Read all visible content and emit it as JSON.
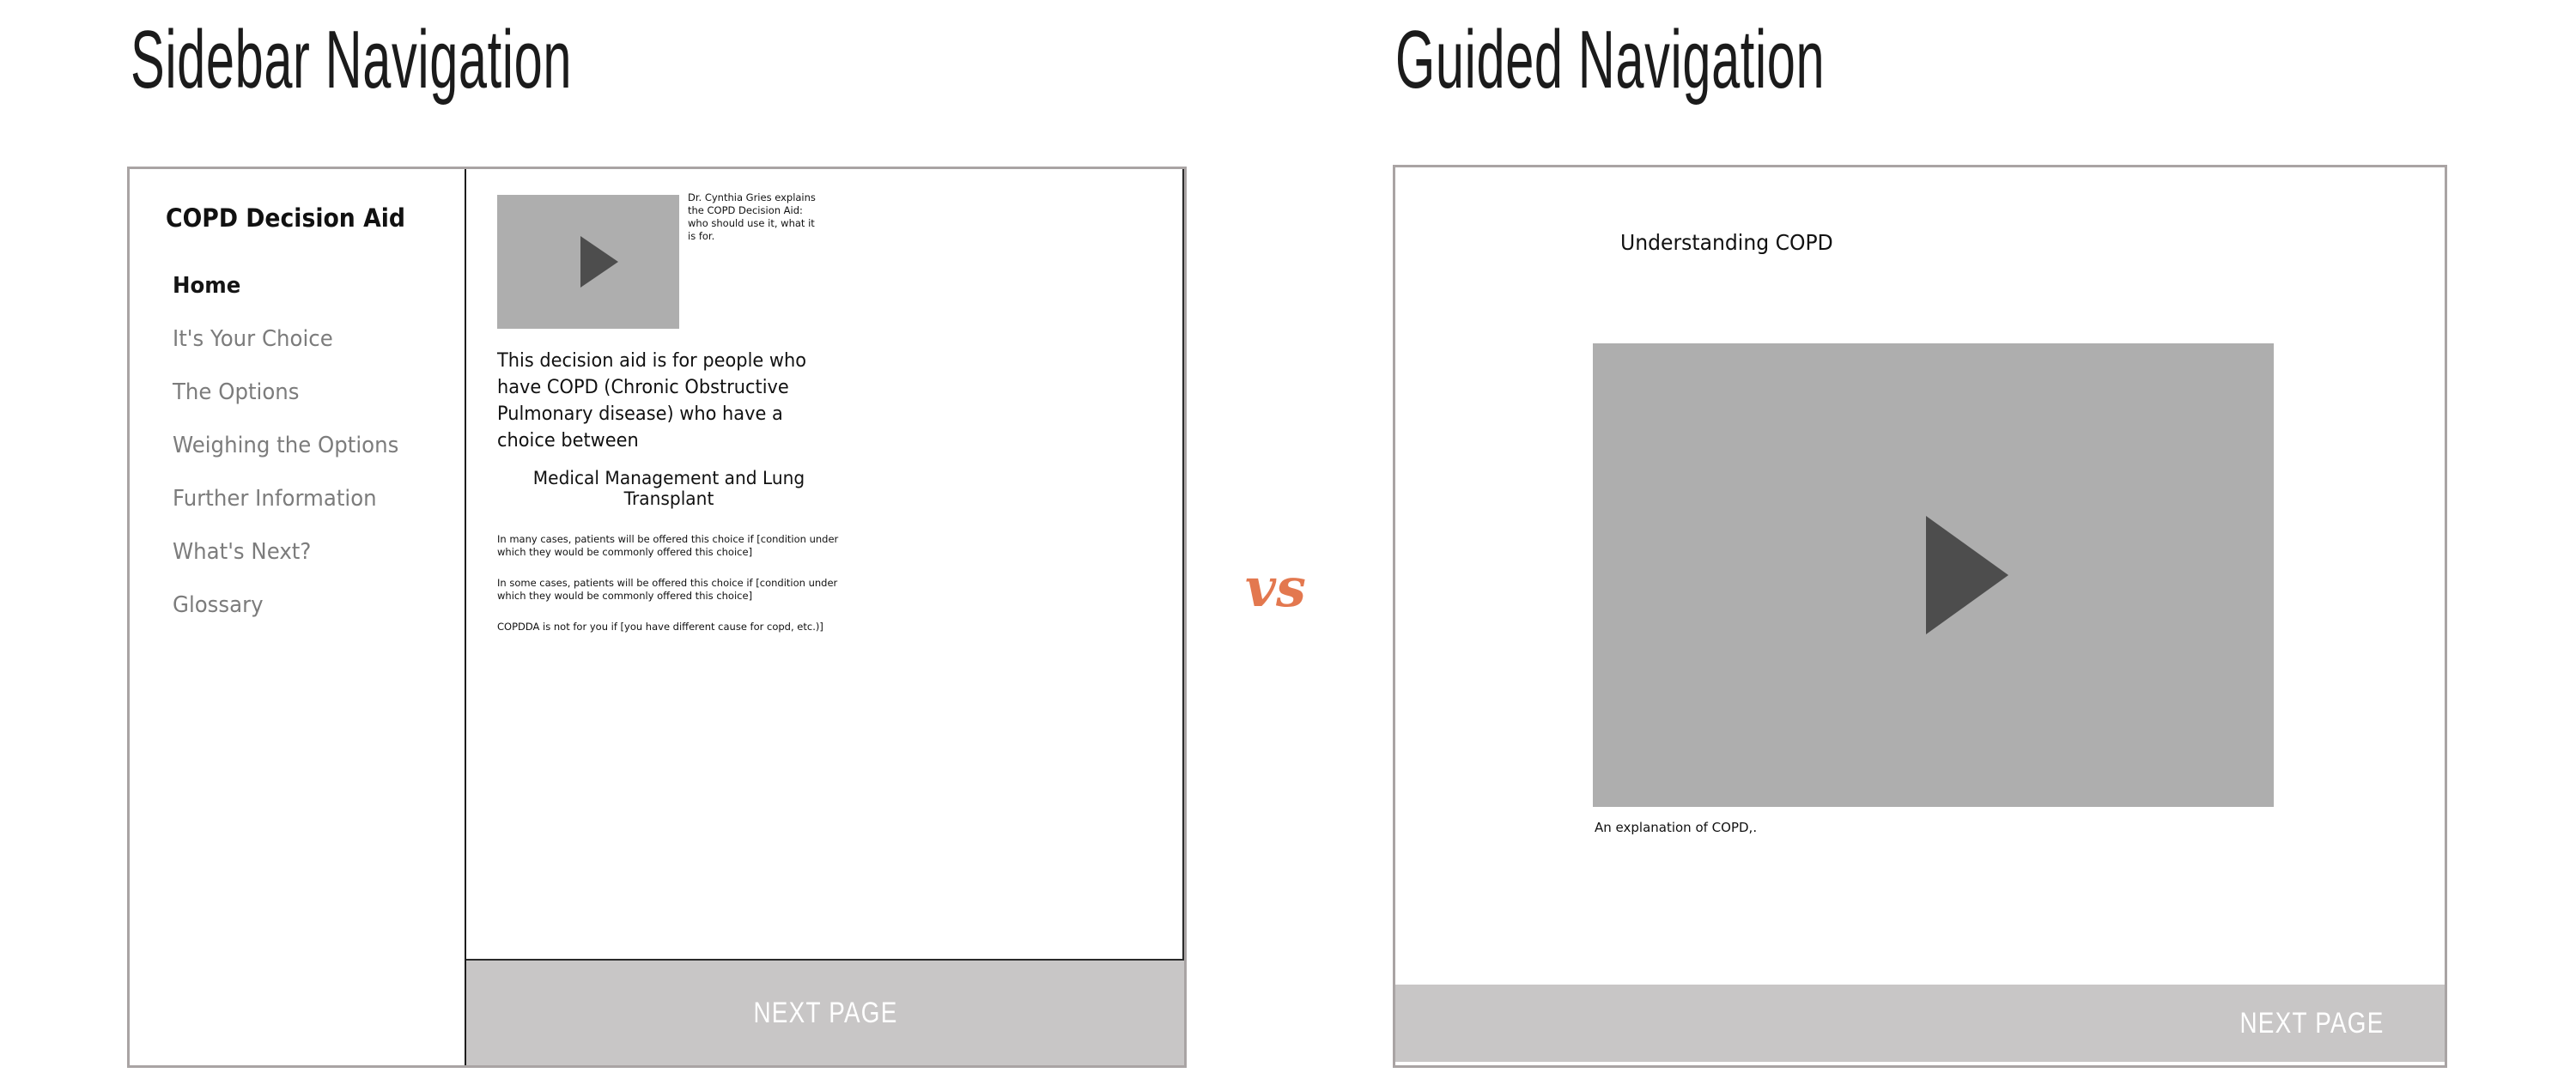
{
  "headings": {
    "left": "Sidebar Navigation",
    "right": "Guided Navigation"
  },
  "separator": {
    "label": "vs",
    "color": "#e3784f"
  },
  "sidebar_mock": {
    "app_title": "COPD Decision Aid",
    "nav_items": [
      {
        "label": "Home",
        "active": true
      },
      {
        "label": "It's Your Choice",
        "active": false
      },
      {
        "label": "The Options",
        "active": false
      },
      {
        "label": "Weighing the Options",
        "active": false
      },
      {
        "label": "Further Information",
        "active": false
      },
      {
        "label": "What's Next?",
        "active": false
      },
      {
        "label": "Glossary",
        "active": false
      }
    ],
    "content": {
      "video_caption": "Dr. Cynthia Gries explains the COPD Decision Aid: who should use it, what it is for.",
      "intro_paragraph": "This decision aid is for people who have COPD (Chronic Obstructive Pulmonary disease) who have a choice between",
      "options_headline": "Medical Management and Lung Transplant",
      "fineprint": [
        "In many cases, patients will be offered this choice if [condition under which they would be commonly offered this choice]",
        "In some cases, patients will be offered this choice if [condition under which they would be commonly offered this choice]",
        "COPDDA is not for you if [you have different cause for copd, etc.)]"
      ],
      "next_page_label": "NEXT PAGE"
    }
  },
  "guided_mock": {
    "page_heading": "Understanding COPD",
    "video_caption": "An explanation of COPD,.",
    "next_page_label": "NEXT PAGE"
  },
  "icons": {
    "play": "play-icon"
  },
  "colors": {
    "frame_border": "#a9a4a4",
    "video_placeholder": "#aeaeae",
    "play_triangle": "#4d4d4d",
    "next_bar": "#c8c6c6",
    "nav_inactive": "#7c7c7c",
    "nav_active": "#141414",
    "accent": "#e3784f"
  }
}
